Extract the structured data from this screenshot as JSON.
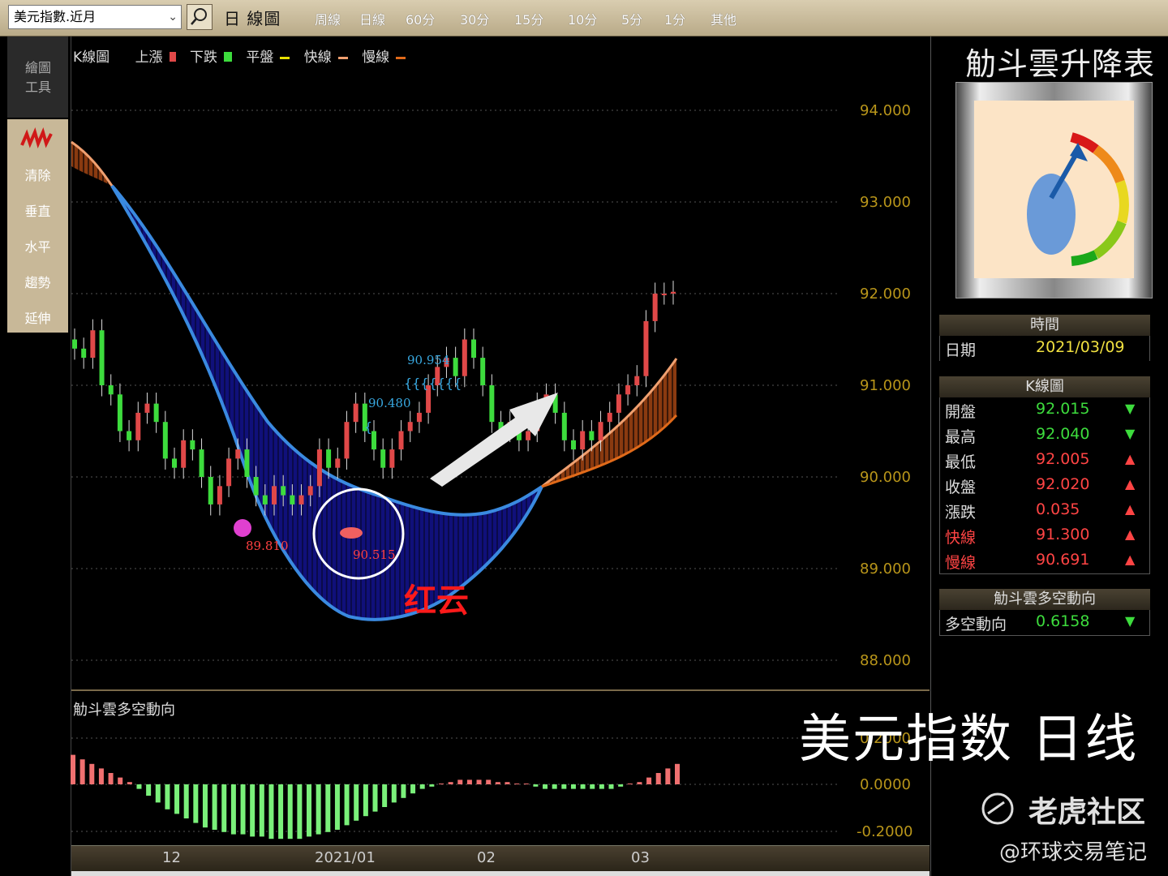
{
  "toolbar": {
    "symbol": "美元指數.近月",
    "chart_title": "日 線圖",
    "periods": [
      "周線",
      "日線",
      "60分",
      "30分",
      "15分",
      "10分",
      "5分",
      "1分",
      "其他"
    ]
  },
  "sidebar": {
    "header": "繪圖\n工具",
    "items": [
      "清除",
      "垂直",
      "水平",
      "趨勢",
      "延伸"
    ]
  },
  "legend": {
    "title": "K線圖",
    "items": [
      {
        "label": "上漲",
        "color": "#e04848"
      },
      {
        "label": "下跌",
        "color": "#3ddc3d"
      },
      {
        "label": "平盤",
        "color": "#e8e000"
      },
      {
        "label": "快線",
        "color": "#f0a070"
      },
      {
        "label": "慢線",
        "color": "#e06a1a"
      }
    ]
  },
  "price_axis": [
    "94.000",
    "93.000",
    "92.000",
    "91.000",
    "90.000",
    "89.000",
    "88.000"
  ],
  "indicator": {
    "title": "觔斗雲多空動向",
    "axis": [
      "0.2000",
      "0.0000",
      "-0.2000"
    ]
  },
  "time_axis": [
    "12",
    "2021/01",
    "02",
    "03"
  ],
  "annotations": {
    "low": "89.810",
    "cloud": "90.515",
    "peak1": "90.954",
    "peak2": "90.480",
    "label": "红云"
  },
  "right_panel": {
    "title": "觔斗雲升降表",
    "time_header": "時間",
    "date_key": "日期",
    "date_val": "2021/03/09",
    "k_header": "K線圖",
    "rows": [
      {
        "k": "開盤",
        "v": "92.015",
        "arrow": "▼",
        "dir": "dn"
      },
      {
        "k": "最高",
        "v": "92.040",
        "arrow": "▼",
        "dir": "dn"
      },
      {
        "k": "最低",
        "v": "92.005",
        "arrow": "▲",
        "dir": "up"
      },
      {
        "k": "收盤",
        "v": "92.020",
        "arrow": "▲",
        "dir": "up"
      },
      {
        "k": "漲跌",
        "v": "0.035",
        "arrow": "▲",
        "dir": "up"
      },
      {
        "k": "快線",
        "v": "91.300",
        "arrow": "▲",
        "dir": "up"
      },
      {
        "k": "慢線",
        "v": "90.691",
        "arrow": "▲",
        "dir": "up"
      }
    ],
    "dir_header": "觔斗雲多空動向",
    "dir_key": "多空動向",
    "dir_val": "0.6158",
    "dir_arrow": "▼"
  },
  "caption": "美元指数  日线",
  "watermark": "老虎社区",
  "watermark_sub": "@环球交易笔记",
  "colors": {
    "up": "#e04848",
    "down": "#3ddc3d",
    "cloud": "#1a1a8a",
    "edge": "#3a8ae0",
    "orange": "#e07828"
  },
  "chart_data": {
    "type": "candlestick",
    "title": "",
    "ylim": [
      88,
      94
    ],
    "open": [
      91.5,
      91.4,
      91.3,
      91.6,
      91.0,
      90.9,
      90.5,
      90.4,
      90.7,
      90.8,
      90.6,
      90.2,
      90.1,
      90.4,
      90.3,
      90.0,
      89.7,
      89.9,
      90.2,
      90.3,
      90.0,
      89.8,
      89.7,
      89.9,
      89.8,
      89.7,
      89.8,
      89.9,
      90.3,
      90.1,
      90.2,
      90.6,
      90.8,
      90.5,
      90.3,
      90.1,
      90.3,
      90.5,
      90.6,
      90.7,
      91.0,
      91.2,
      91.3,
      91.1,
      91.5,
      91.3,
      91.0,
      90.6,
      90.5,
      90.6,
      90.4,
      90.5,
      90.8,
      90.9,
      90.7,
      90.4,
      90.3,
      90.5,
      90.4,
      90.6,
      90.7,
      90.9,
      91.0,
      91.1,
      91.7,
      92.0,
      92.0
    ],
    "close": [
      91.4,
      91.3,
      91.6,
      91.0,
      90.9,
      90.5,
      90.4,
      90.7,
      90.8,
      90.6,
      90.2,
      90.1,
      90.4,
      90.3,
      90.0,
      89.7,
      89.9,
      90.2,
      90.3,
      90.0,
      89.8,
      89.7,
      89.9,
      89.8,
      89.7,
      89.8,
      89.9,
      90.3,
      90.1,
      90.2,
      90.6,
      90.8,
      90.5,
      90.3,
      90.1,
      90.3,
      90.5,
      90.6,
      90.7,
      91.0,
      91.2,
      91.3,
      91.1,
      91.5,
      91.3,
      91.0,
      90.6,
      90.5,
      90.6,
      90.4,
      90.5,
      90.8,
      90.9,
      90.7,
      90.4,
      90.3,
      90.5,
      90.4,
      90.6,
      90.7,
      90.9,
      91.0,
      91.1,
      91.7,
      92.0,
      92.0,
      92.02
    ],
    "fast_line_last": 91.3,
    "slow_line_last": 90.691,
    "indicator_values": [
      0.13,
      0.11,
      0.09,
      0.07,
      0.05,
      0.03,
      0.01,
      -0.02,
      -0.05,
      -0.08,
      -0.11,
      -0.13,
      -0.15,
      -0.17,
      -0.19,
      -0.2,
      -0.21,
      -0.22,
      -0.22,
      -0.23,
      -0.23,
      -0.24,
      -0.24,
      -0.24,
      -0.24,
      -0.23,
      -0.22,
      -0.21,
      -0.2,
      -0.18,
      -0.16,
      -0.14,
      -0.12,
      -0.1,
      -0.08,
      -0.06,
      -0.04,
      -0.02,
      -0.01,
      0.0,
      0.01,
      0.02,
      0.02,
      0.02,
      0.02,
      0.01,
      0.01,
      0.0,
      0.0,
      -0.01,
      -0.02,
      -0.02,
      -0.02,
      -0.02,
      -0.02,
      -0.02,
      -0.02,
      -0.02,
      -0.01,
      0.0,
      0.01,
      0.03,
      0.05,
      0.07,
      0.09
    ]
  }
}
